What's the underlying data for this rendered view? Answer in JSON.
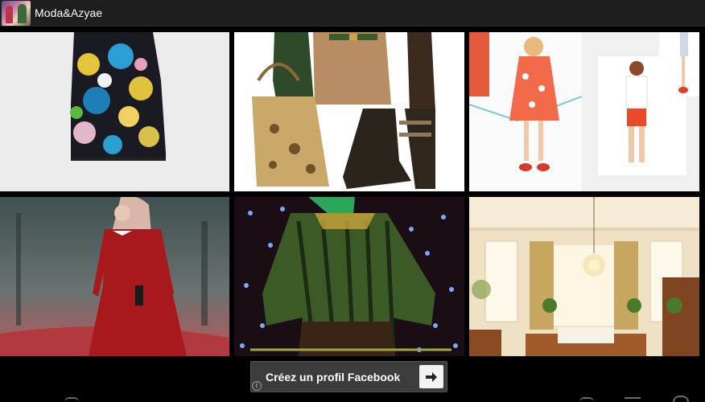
{
  "app": {
    "title": "Moda&Azyae",
    "icon": "app-logo-icon"
  },
  "gallery": {
    "tiles": [
      {
        "name": "floral-dress-photo"
      },
      {
        "name": "outfit-bag-boots-photo"
      },
      {
        "name": "kids-fashion-photo"
      },
      {
        "name": "red-dress-hijab-photo"
      },
      {
        "name": "green-blouse-runway-photo"
      },
      {
        "name": "bedroom-interior-photo"
      }
    ]
  },
  "ad": {
    "label": "Créez un profil Facebook",
    "arrow_icon": "arrow-right-icon",
    "info_icon": "info-icon",
    "info_glyph": "i"
  },
  "colors": {
    "action_bar": "#1e1e1e",
    "background": "#000000",
    "ad_background": "#3c3c3c"
  }
}
